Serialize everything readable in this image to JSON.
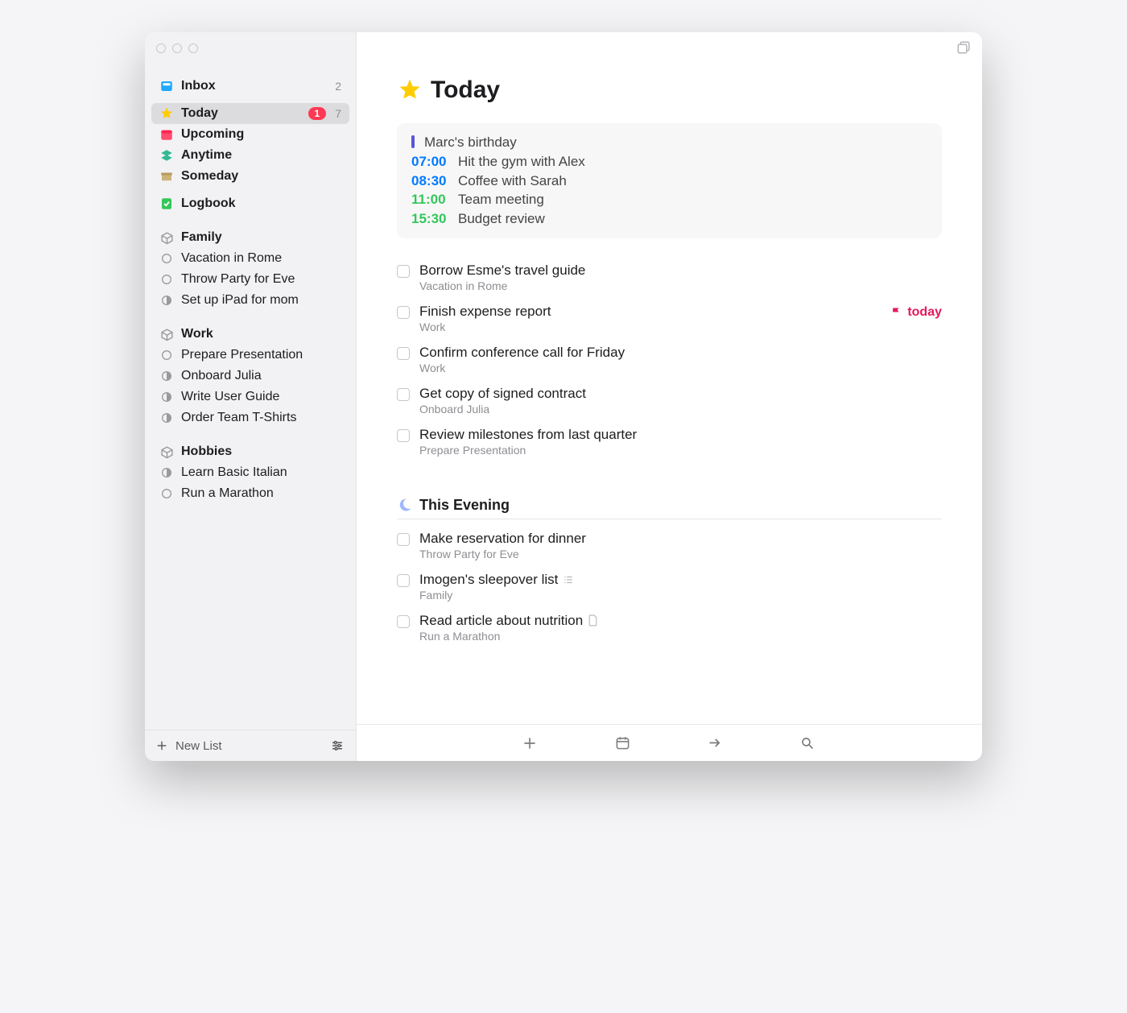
{
  "sidebar": {
    "inbox": {
      "label": "Inbox",
      "count": "2"
    },
    "today": {
      "label": "Today",
      "badge": "1",
      "count": "7"
    },
    "upcoming": {
      "label": "Upcoming"
    },
    "anytime": {
      "label": "Anytime"
    },
    "someday": {
      "label": "Someday"
    },
    "logbook": {
      "label": "Logbook"
    },
    "areas": [
      {
        "name": "Family",
        "projects": [
          "Vacation in Rome",
          "Throw Party for Eve",
          "Set up iPad for mom"
        ]
      },
      {
        "name": "Work",
        "projects": [
          "Prepare Presentation",
          "Onboard Julia",
          "Write User Guide",
          "Order Team T-Shirts"
        ]
      },
      {
        "name": "Hobbies",
        "projects": [
          "Learn Basic Italian",
          "Run a Marathon"
        ]
      }
    ],
    "new_list_label": "New List"
  },
  "main": {
    "title": "Today",
    "schedule": [
      {
        "bar": true,
        "text": "Marc's birthday"
      },
      {
        "time": "07:00",
        "color": "blue",
        "text": "Hit the gym with Alex"
      },
      {
        "time": "08:30",
        "color": "blue",
        "text": "Coffee with Sarah"
      },
      {
        "time": "11:00",
        "color": "green",
        "text": "Team meeting"
      },
      {
        "time": "15:30",
        "color": "green",
        "text": "Budget review"
      }
    ],
    "tasks": [
      {
        "title": "Borrow Esme's travel guide",
        "sub": "Vacation in Rome"
      },
      {
        "title": "Finish expense report",
        "sub": "Work",
        "deadline": "today"
      },
      {
        "title": "Confirm conference call for Friday",
        "sub": "Work"
      },
      {
        "title": "Get copy of signed contract",
        "sub": "Onboard Julia"
      },
      {
        "title": "Review milestones from last quarter",
        "sub": "Prepare Presentation"
      }
    ],
    "evening_heading": "This Evening",
    "evening_tasks": [
      {
        "title": "Make reservation for dinner",
        "sub": "Throw Party for Eve"
      },
      {
        "title": "Imogen's sleepover list",
        "sub": "Family",
        "checklist": true
      },
      {
        "title": "Read article about nutrition",
        "sub": "Run a Marathon",
        "attachment": true
      }
    ]
  }
}
